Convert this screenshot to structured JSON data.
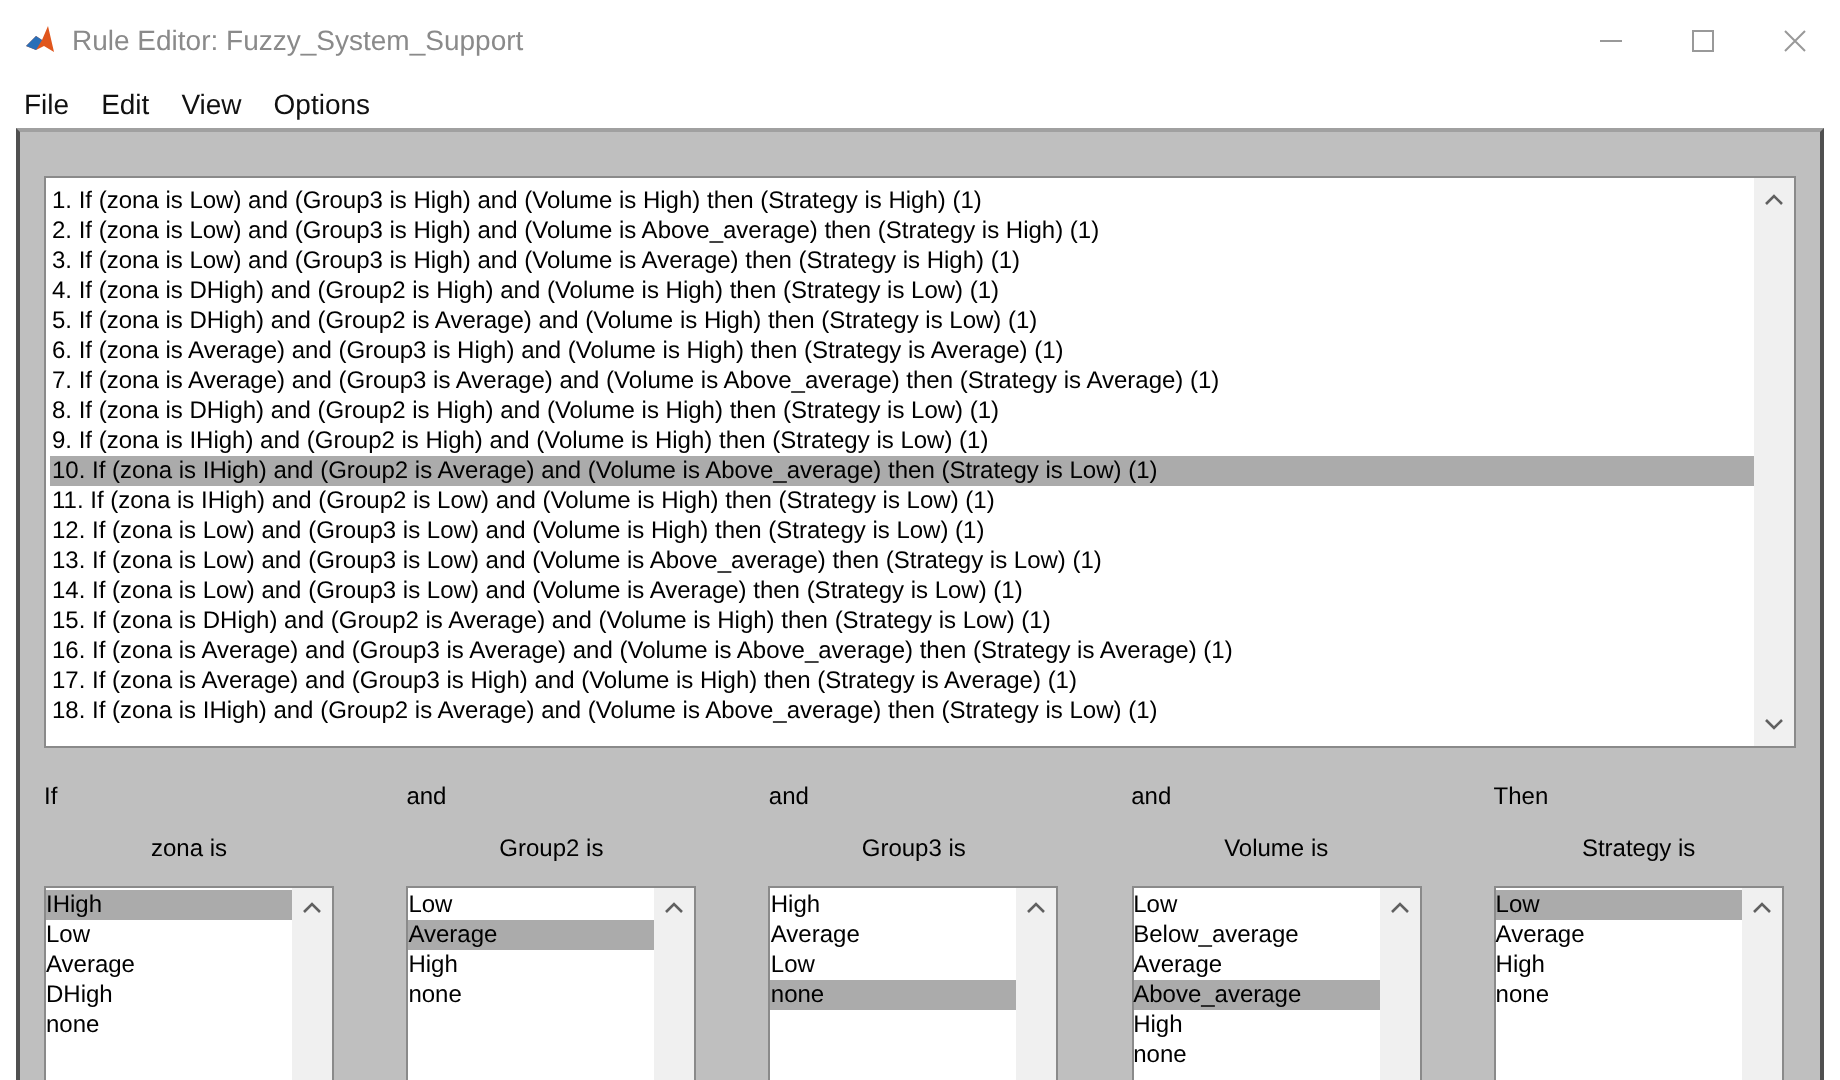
{
  "window": {
    "title": "Rule Editor: Fuzzy_System_Support"
  },
  "menu": [
    "File",
    "Edit",
    "View",
    "Options"
  ],
  "rules": [
    {
      "text": "1. If (zona is Low) and (Group3 is High) and (Volume is High) then (Strategy is High) (1)",
      "selected": false
    },
    {
      "text": "2. If (zona is Low) and (Group3 is High) and (Volume is Above_average) then (Strategy is High) (1)",
      "selected": false
    },
    {
      "text": "3. If (zona is Low) and (Group3 is High) and (Volume is Average) then (Strategy is High) (1)",
      "selected": false
    },
    {
      "text": "4. If (zona is DHigh) and (Group2 is High) and (Volume is High) then (Strategy is Low) (1)",
      "selected": false
    },
    {
      "text": "5. If (zona is DHigh) and (Group2 is Average) and (Volume is High) then (Strategy is Low) (1)",
      "selected": false
    },
    {
      "text": "6. If (zona is Average) and (Group3 is High) and (Volume is High) then (Strategy is Average) (1)",
      "selected": false
    },
    {
      "text": "7. If (zona is Average) and (Group3 is Average) and (Volume is Above_average) then (Strategy is Average) (1)",
      "selected": false
    },
    {
      "text": "8. If (zona is DHigh) and (Group2 is High) and (Volume is High) then (Strategy is Low) (1)",
      "selected": false
    },
    {
      "text": "9. If (zona is IHigh) and (Group2 is High) and (Volume is High) then (Strategy is Low) (1)",
      "selected": false
    },
    {
      "text": "10. If (zona is IHigh) and (Group2 is Average) and (Volume is Above_average) then (Strategy is Low) (1)",
      "selected": true
    },
    {
      "text": "11. If (zona is IHigh) and (Group2 is Low) and (Volume is High) then (Strategy is Low) (1)",
      "selected": false
    },
    {
      "text": "12. If (zona is Low) and (Group3 is Low) and (Volume is High) then (Strategy is Low) (1)",
      "selected": false
    },
    {
      "text": "13. If (zona is Low) and (Group3 is Low) and (Volume is Above_average) then (Strategy is Low) (1)",
      "selected": false
    },
    {
      "text": "14. If (zona is Low) and (Group3 is Low) and (Volume is Average) then (Strategy is Low) (1)",
      "selected": false
    },
    {
      "text": "15. If (zona is DHigh) and (Group2 is Average) and (Volume is High) then (Strategy is Low) (1)",
      "selected": false
    },
    {
      "text": "16. If (zona is Average) and (Group3 is Average) and (Volume is Above_average) then (Strategy is Average) (1)",
      "selected": false
    },
    {
      "text": "17. If (zona is Average) and (Group3 is High) and (Volume is High) then (Strategy is Average) (1)",
      "selected": false
    },
    {
      "text": "18. If (zona is IHigh) and (Group2 is Average) and (Volume is Above_average) then (Strategy is Low) (1)",
      "selected": false
    }
  ],
  "variables": [
    {
      "connector": "If",
      "header": "zona is",
      "options": [
        {
          "label": "IHigh",
          "selected": true
        },
        {
          "label": "Low",
          "selected": false
        },
        {
          "label": "Average",
          "selected": false
        },
        {
          "label": "DHigh",
          "selected": false
        },
        {
          "label": "none",
          "selected": false
        }
      ]
    },
    {
      "connector": "and",
      "header": "Group2 is",
      "options": [
        {
          "label": "Low",
          "selected": false
        },
        {
          "label": "Average",
          "selected": true
        },
        {
          "label": "High",
          "selected": false
        },
        {
          "label": "none",
          "selected": false
        }
      ]
    },
    {
      "connector": "and",
      "header": "Group3 is",
      "options": [
        {
          "label": "High",
          "selected": false
        },
        {
          "label": "Average",
          "selected": false
        },
        {
          "label": "Low",
          "selected": false
        },
        {
          "label": "none",
          "selected": true
        }
      ]
    },
    {
      "connector": "and",
      "header": "Volume is",
      "options": [
        {
          "label": "Low",
          "selected": false
        },
        {
          "label": "Below_average",
          "selected": false
        },
        {
          "label": "Average",
          "selected": false
        },
        {
          "label": "Above_average",
          "selected": true
        },
        {
          "label": "High",
          "selected": false
        },
        {
          "label": "none",
          "selected": false
        }
      ]
    },
    {
      "connector": "Then",
      "header": "Strategy is",
      "options": [
        {
          "label": "Low",
          "selected": true
        },
        {
          "label": "Average",
          "selected": false
        },
        {
          "label": "High",
          "selected": false
        },
        {
          "label": "none",
          "selected": false
        }
      ]
    }
  ]
}
